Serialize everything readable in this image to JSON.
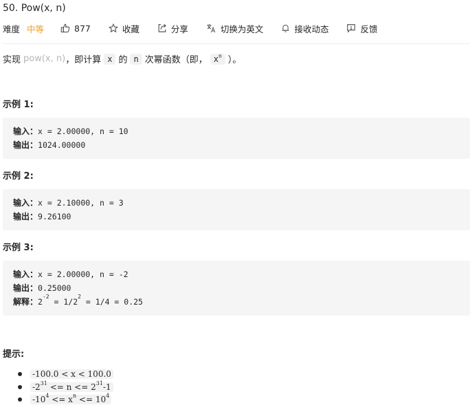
{
  "title": "50. Pow(x, n)",
  "meta": {
    "difficulty_label": "难度",
    "difficulty_value": "中等",
    "likes": "877",
    "favorite": "收藏",
    "share": "分享",
    "translate": "切换为英文",
    "subscribe": "接收动态",
    "feedback": "反馈"
  },
  "description": {
    "prefix": "实现",
    "pow": "pow(x, n)",
    "mid1": "，即计算",
    "x": "x",
    "mid2": "的",
    "n": "n",
    "mid3": "次幂函数（即，",
    "xn_base": "x",
    "xn_exp": "n",
    "suffix": "）。"
  },
  "examples": [
    {
      "title": "示例 1:",
      "input_label": "输入：",
      "input": "x = 2.00000, n = 10",
      "output_label": "输出：",
      "output": "1024.00000"
    },
    {
      "title": "示例 2:",
      "input_label": "输入：",
      "input": "x = 2.10000, n = 3",
      "output_label": "输出：",
      "output": "9.26100"
    },
    {
      "title": "示例 3:",
      "input_label": "输入：",
      "input": "x = 2.00000, n = -2",
      "output_label": "输出：",
      "output": "0.25000",
      "explain_label": "解释：",
      "explain_base": "2",
      "explain_exp": "-2",
      "explain_mid": " = 1/2",
      "explain_exp2": "2",
      "explain_end": " = 1/4 = 0.25"
    }
  ],
  "hints": {
    "title": "提示:",
    "c1": "-100.0 < x < 100.0",
    "c2_a": "-2",
    "c2_e1": "31",
    "c2_b": " <= n <= 2",
    "c2_e2": "31",
    "c2_c": "-1",
    "c3_a": "-10",
    "c3_e1": "4",
    "c3_b": " <= x",
    "c3_e2": "n",
    "c3_c": " <= 10",
    "c3_e3": "4"
  }
}
